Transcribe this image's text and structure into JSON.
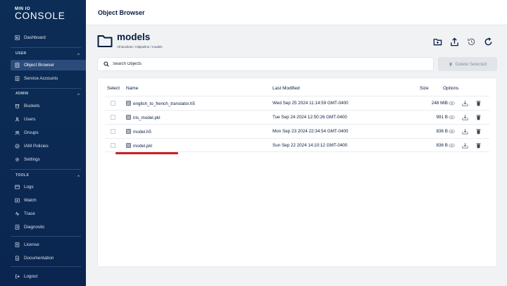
{
  "logo": {
    "small": "MIN IO",
    "big": "CONSOLE"
  },
  "sidebar": {
    "dashboard": "Dashboard",
    "user_section": "USER",
    "object_browser": "Object Browser",
    "service_accounts": "Service Accounts",
    "admin_section": "ADMIN",
    "buckets": "Buckets",
    "users": "Users",
    "groups": "Groups",
    "iam_policies": "IAM Policies",
    "settings": "Settings",
    "tools_section": "TOOLS",
    "logs": "Logs",
    "watch": "Watch",
    "trace": "Trace",
    "diagnostic": "Diagnostic",
    "license": "License",
    "documentation": "Documentation",
    "logout": "Logout"
  },
  "header": {
    "title": "Object Browser"
  },
  "bucket": {
    "name": "models",
    "breadcrumb": "All Buckets / mlpipeline / models"
  },
  "search": {
    "placeholder": "Search Objects"
  },
  "toolbar": {
    "delete_label": "Delete Selected"
  },
  "table": {
    "headers": {
      "select": "Select",
      "name": "Name",
      "last_modified": "Last Modified",
      "size": "Size",
      "options": "Options"
    },
    "rows": [
      {
        "name": "english_to_french_translator.h5",
        "last_modified": "Wed Sep 25 2024 11:14:59 GMT-0400",
        "size": "248 MiB"
      },
      {
        "name": "iris_model.pkl",
        "last_modified": "Tue Sep 24 2024 12:50:26 GMT-0400",
        "size": "991 B"
      },
      {
        "name": "model.h5",
        "last_modified": "Mon Sep 23 2024 22:34:54 GMT-0400",
        "size": "836 B"
      },
      {
        "name": "model.pkl",
        "last_modified": "Sun Sep 22 2024 14:10:12 GMT-0400",
        "size": "836 B"
      }
    ]
  },
  "colors": {
    "sidebar_bg": "#0c2d56",
    "sidebar_active": "#2b4c7a",
    "highlight": "#c82020",
    "text": "#081c42"
  },
  "icons": [
    "dashboard-icon",
    "object-browser-icon",
    "service-accounts-icon",
    "buckets-icon",
    "users-icon",
    "groups-icon",
    "iam-policies-icon",
    "settings-icon",
    "logs-icon",
    "watch-icon",
    "trace-icon",
    "diagnostic-icon",
    "license-icon",
    "documentation-icon",
    "logout-icon",
    "folder-icon",
    "new-folder-icon",
    "upload-icon",
    "history-icon",
    "refresh-icon",
    "search-icon",
    "trash-icon",
    "file-icon",
    "eye-icon",
    "download-icon"
  ]
}
